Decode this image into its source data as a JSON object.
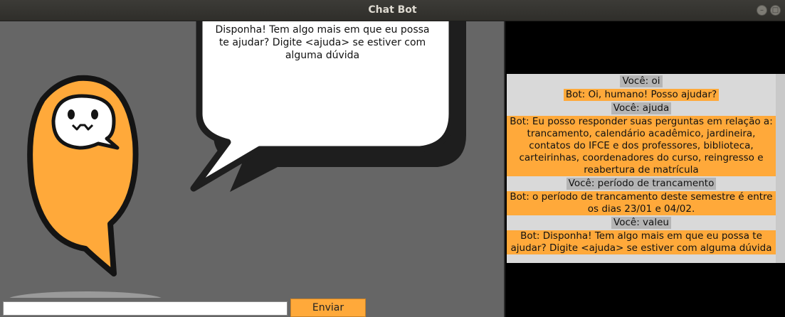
{
  "window": {
    "title": "Chat Bot"
  },
  "bubble": {
    "text": "Disponha! Tem algo mais em que eu possa te ajudar? Digite <ajuda> se estiver com alguma dúvida"
  },
  "messages": [
    {
      "role": "user",
      "text": "Você: oi"
    },
    {
      "role": "bot",
      "text": "Bot: Oi, humano! Posso ajudar?"
    },
    {
      "role": "user",
      "text": "Você: ajuda"
    },
    {
      "role": "bot",
      "text": "Bot: Eu posso responder suas perguntas em relação a: trancamento, calendário acadêmico, jardineira, contatos do IFCE e dos professores, biblioteca, carteirinhas, coordenadores do curso, reingresso e reabertura de matrícula"
    },
    {
      "role": "user",
      "text": "Você: período de trancamento"
    },
    {
      "role": "bot",
      "text": "Bot: o período de trancamento deste semestre é entre os dias 23/01 e 04/02."
    },
    {
      "role": "user",
      "text": "Você: valeu"
    },
    {
      "role": "bot",
      "text": "Bot: Disponha! Tem algo mais em que eu possa te ajudar? Digite <ajuda> se estiver com alguma dúvida"
    }
  ],
  "input": {
    "value": ""
  },
  "send": {
    "label": "Enviar"
  },
  "colors": {
    "accent": "#ffa93a",
    "user_bg": "#b5b5b5",
    "log_bg": "#d9d9d9",
    "scene_bg": "#666666"
  }
}
